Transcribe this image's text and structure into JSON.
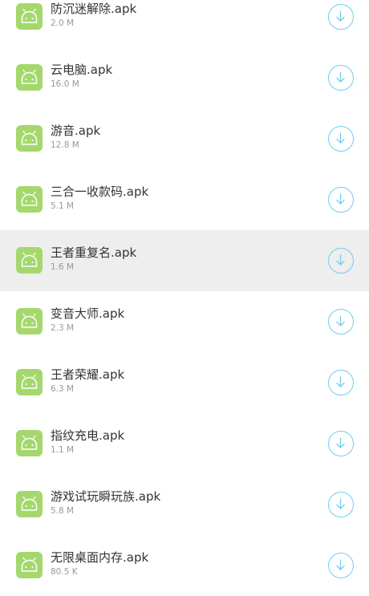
{
  "files": [
    {
      "name": "防沉迷解除.apk",
      "size": "2.0 M",
      "icon": "android-icon",
      "action_icon": "download-icon"
    },
    {
      "name": "云电脑.apk",
      "size": "16.0 M",
      "icon": "android-icon",
      "action_icon": "download-icon"
    },
    {
      "name": "游音.apk",
      "size": "12.8 M",
      "icon": "android-icon",
      "action_icon": "download-icon"
    },
    {
      "name": "三合一收款码.apk",
      "size": "5.1 M",
      "icon": "android-icon",
      "action_icon": "download-icon"
    },
    {
      "name": "王者重复名.apk",
      "size": "1.6 M",
      "icon": "android-icon",
      "action_icon": "download-icon"
    },
    {
      "name": "变音大师.apk",
      "size": "2.3 M",
      "icon": "android-icon",
      "action_icon": "download-icon"
    },
    {
      "name": "王者荣耀.apk",
      "size": "6.3 M",
      "icon": "android-icon",
      "action_icon": "download-icon"
    },
    {
      "name": "指纹充电.apk",
      "size": "1.1 M",
      "icon": "android-icon",
      "action_icon": "download-icon"
    },
    {
      "name": "游戏试玩瞬玩族.apk",
      "size": "5.8 M",
      "icon": "android-icon",
      "action_icon": "download-icon"
    },
    {
      "name": "无限桌面内存.apk",
      "size": "80.5 K",
      "icon": "android-icon",
      "action_icon": "download-icon"
    }
  ],
  "highlighted_index": 4,
  "colors": {
    "icon_bg": "#a5d86c",
    "accent": "#72ccef",
    "highlight_bg": "#eeeeee",
    "name_text": "#333333",
    "size_text": "#9a9a9a"
  }
}
